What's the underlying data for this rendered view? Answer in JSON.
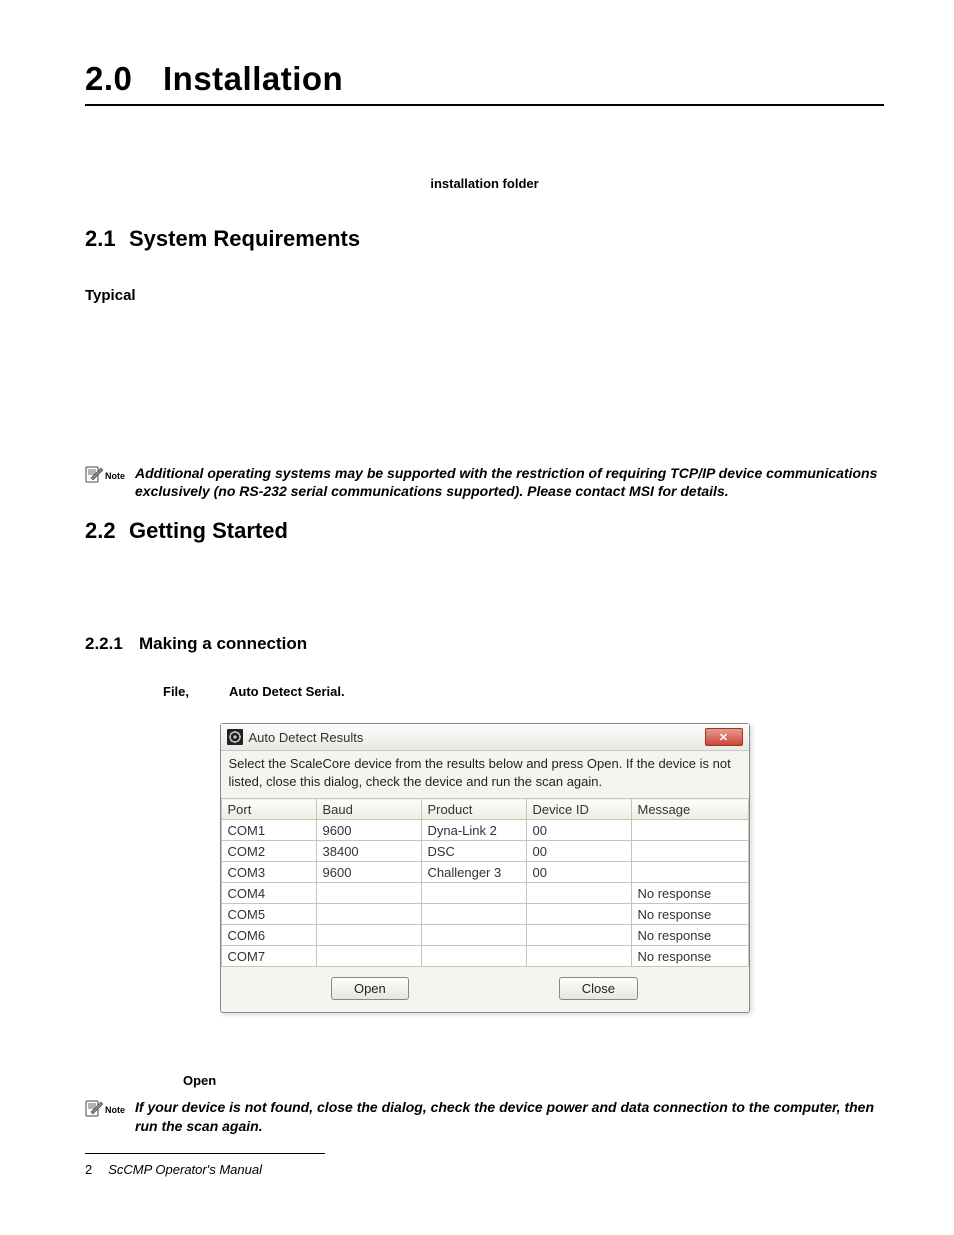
{
  "chapter": {
    "number": "2.0",
    "title": "Installation"
  },
  "installation_folder_label": "installation folder",
  "section_2_1": {
    "number": "2.1",
    "title": "System Requirements"
  },
  "typical_label": "Typical",
  "note1": {
    "label": "Note",
    "text": "Additional operating systems may be supported with the restriction of requiring TCP/IP device communications exclusively (no RS-232 serial communications supported). Please contact MSI for details."
  },
  "section_2_2": {
    "number": "2.2",
    "title": "Getting Started"
  },
  "section_2_2_1": {
    "number": "2.2.1",
    "title": "Making a connection"
  },
  "instruction": {
    "menu": "File,",
    "action": "Auto  Detect  Serial."
  },
  "dialog": {
    "title": "Auto Detect Results",
    "close_glyph": "✕",
    "instruction": "Select the ScaleCore device from the results below and press Open. If the device is not listed, close this dialog, check the device and run the scan again.",
    "columns": [
      "Port",
      "Baud",
      "Product",
      "Device ID",
      "Message"
    ],
    "rows": [
      {
        "port": "COM1",
        "baud": "9600",
        "product": "Dyna-Link 2",
        "device_id": "00",
        "message": ""
      },
      {
        "port": "COM2",
        "baud": "38400",
        "product": "DSC",
        "device_id": "00",
        "message": ""
      },
      {
        "port": "COM3",
        "baud": "9600",
        "product": "Challenger 3",
        "device_id": "00",
        "message": ""
      },
      {
        "port": "COM4",
        "baud": "",
        "product": "",
        "device_id": "",
        "message": "No response"
      },
      {
        "port": "COM5",
        "baud": "",
        "product": "",
        "device_id": "",
        "message": "No response"
      },
      {
        "port": "COM6",
        "baud": "",
        "product": "",
        "device_id": "",
        "message": "No response"
      },
      {
        "port": "COM7",
        "baud": "",
        "product": "",
        "device_id": "",
        "message": "No response"
      }
    ],
    "open_btn": "Open",
    "close_btn": "Close"
  },
  "open_word": "Open",
  "note2": {
    "label": "Note",
    "text": "If your device is not found, close the dialog, check the device power and data connection to the computer, then run the scan again."
  },
  "footer": {
    "page": "2",
    "title": "ScCMP Operator's Manual"
  }
}
